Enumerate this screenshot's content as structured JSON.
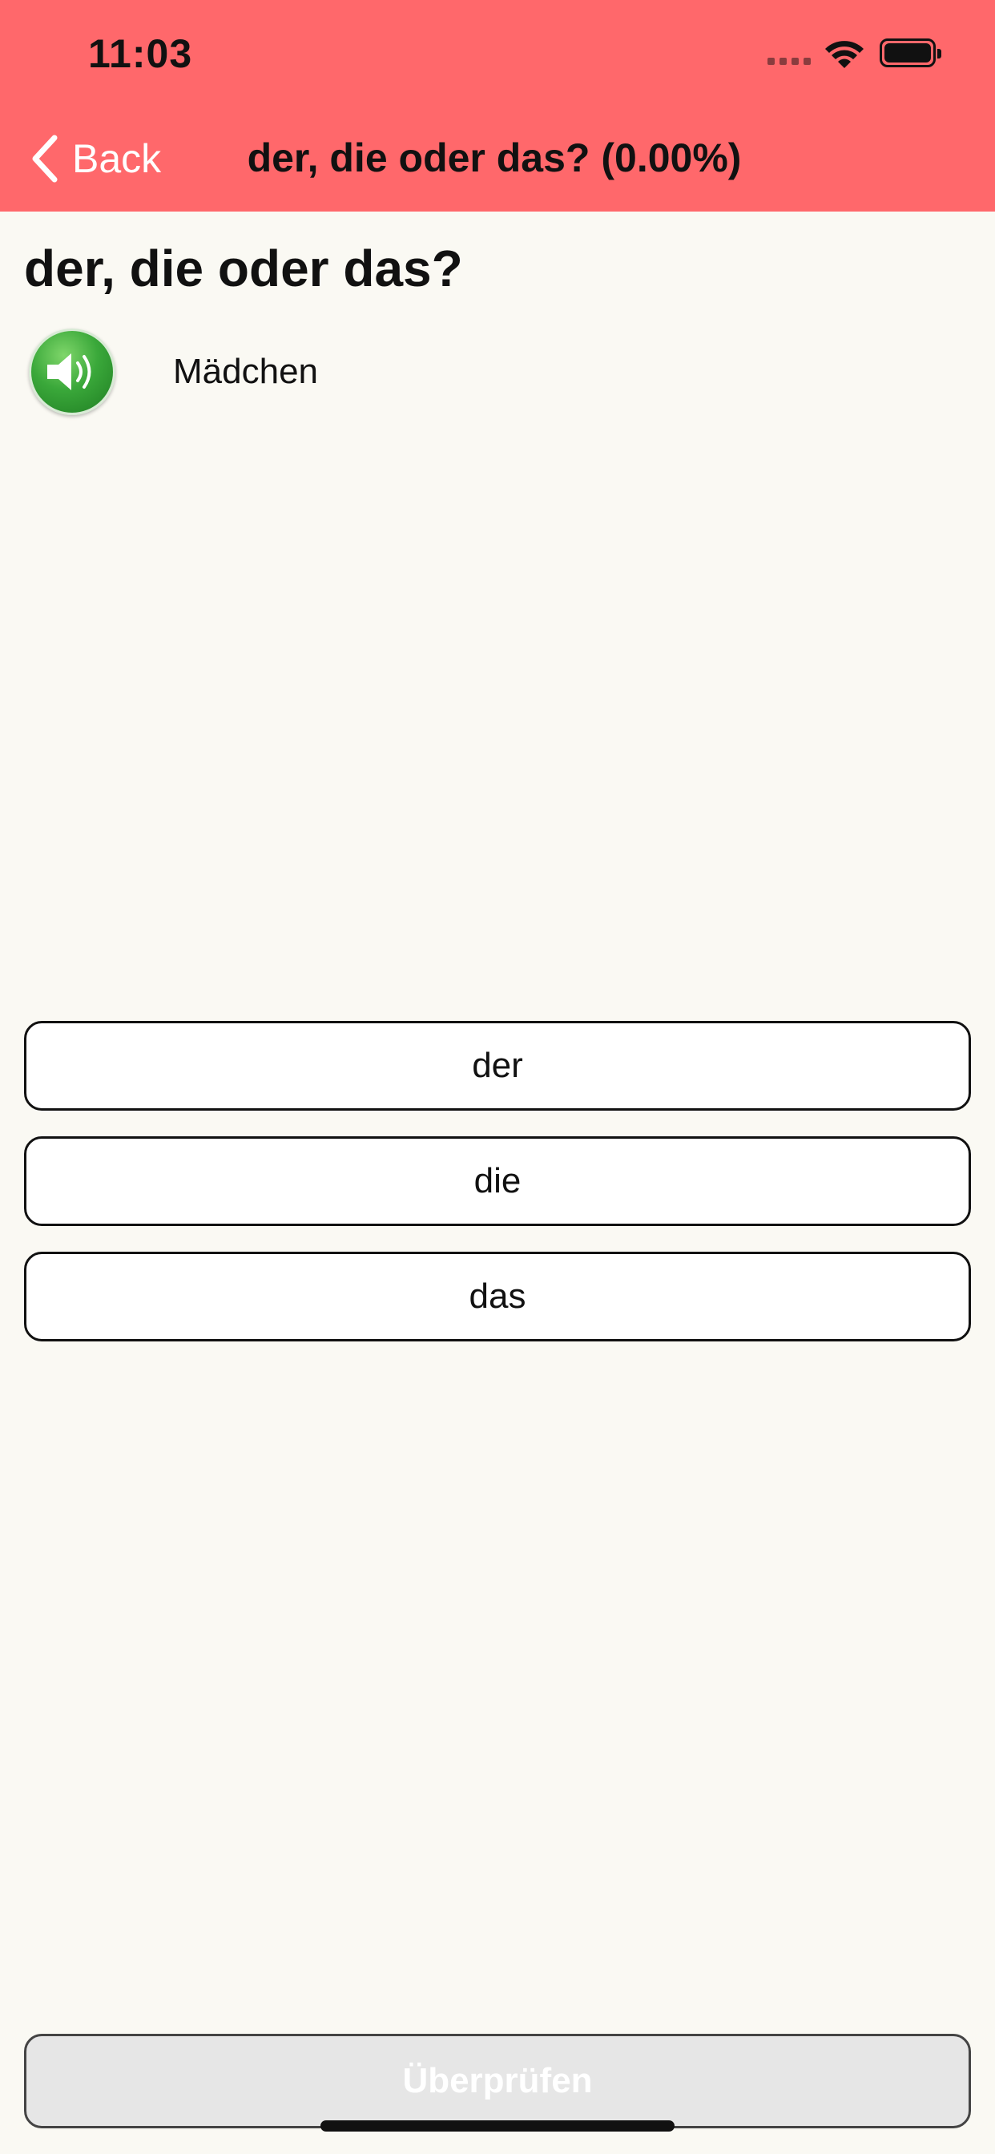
{
  "status_bar": {
    "time": "11:03"
  },
  "nav": {
    "back_label": "Back",
    "title": "der, die oder das? (0.00%)"
  },
  "main": {
    "title": "der, die oder das?",
    "word": "Mädchen",
    "speaker_icon": "speaker-icon",
    "answers": [
      {
        "label": "der"
      },
      {
        "label": "die"
      },
      {
        "label": "das"
      }
    ],
    "check_label": "Überprüfen"
  },
  "colors": {
    "header": "#ff686b",
    "background": "#faf9f3",
    "speaker": "#3aa83a"
  }
}
